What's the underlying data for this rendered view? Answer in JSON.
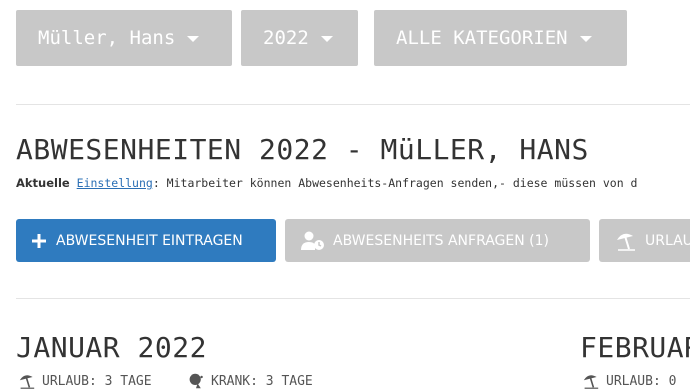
{
  "filters": {
    "person": "Müller, Hans",
    "year": "2022",
    "category": "ALLE KATEGORIEN"
  },
  "header": {
    "title": "ABWESENHEITEN 2022 - MüLLER, HANS"
  },
  "setting": {
    "prefix": "Aktuelle",
    "link": "Einstellung",
    "text": ": Mitarbeiter können Abwesenheits-Anfragen senden,- diese müssen von d"
  },
  "actions": {
    "add_label": "ABWESENHEIT EINTRAGEN",
    "requests_label": "ABWESENHEITS ANFRAGEN (1)",
    "vacation_label": "URLAU"
  },
  "months": [
    {
      "name": "JANUAR 2022",
      "stats": [
        {
          "icon": "beach-umbrella-icon",
          "label": "URLAUB: 3 TAGE"
        },
        {
          "icon": "sick-icon",
          "label": "KRANK: 3 TAGE"
        }
      ]
    },
    {
      "name": "FEBRUAR",
      "stats": [
        {
          "icon": "beach-umbrella-icon",
          "label": "URLAUB: 0"
        }
      ]
    }
  ],
  "colors": {
    "primary": "#2f7bbf",
    "button_gray": "#c8c8c8",
    "link": "#2a6fb5"
  }
}
